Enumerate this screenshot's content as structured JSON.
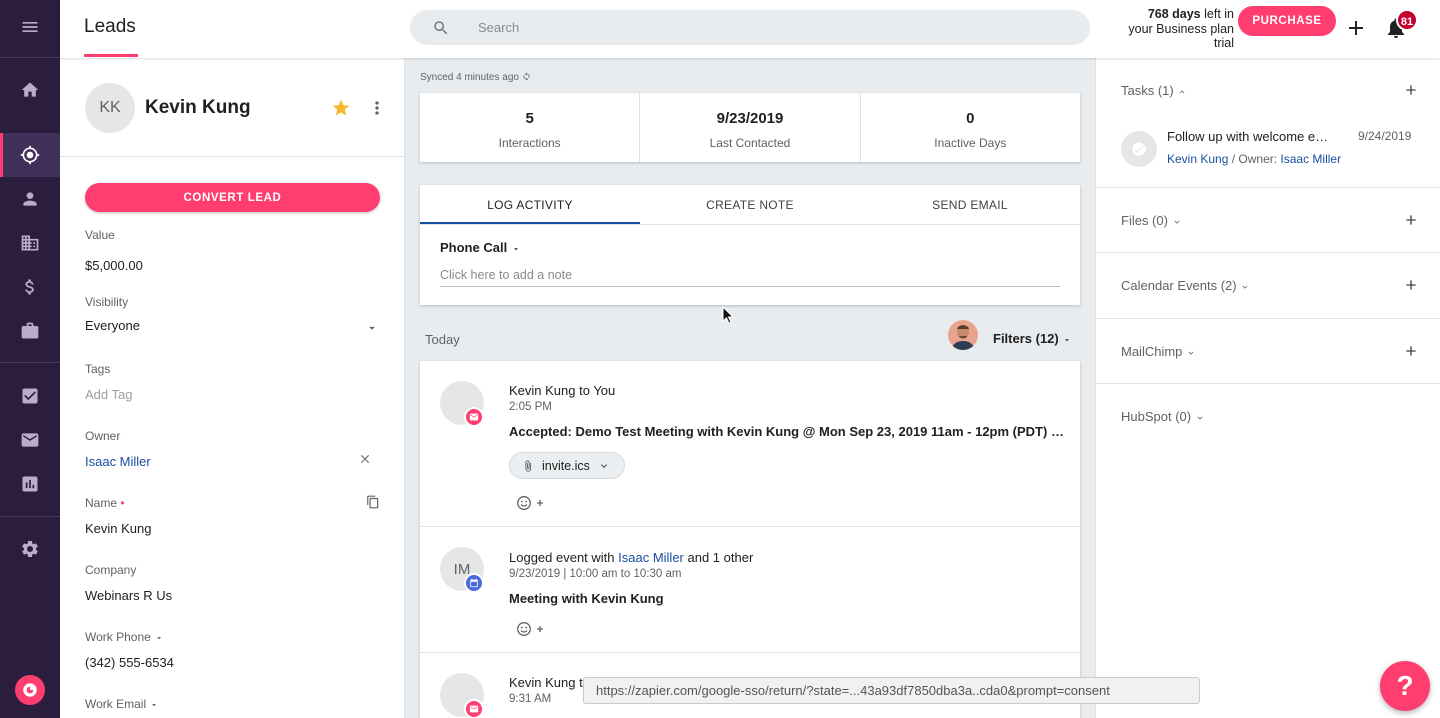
{
  "header": {
    "title": "Leads",
    "search_placeholder": "Search",
    "trial_days": "768 days",
    "trial_rest_1": " left in",
    "trial_rest_2": "your Business plan",
    "trial_rest_3": "trial",
    "purchase_label": "PURCHASE",
    "notifications_count": "81"
  },
  "lead": {
    "initials": "KK",
    "name": "Kevin Kung",
    "convert_label": "CONVERT LEAD",
    "fields": {
      "value_label": "Value",
      "value": "$5,000.00",
      "visibility_label": "Visibility",
      "visibility": "Everyone",
      "tags_label": "Tags",
      "tags_placeholder": "Add Tag",
      "owner_label": "Owner",
      "owner": "Isaac Miller",
      "name_label": "Name",
      "name_required": "•",
      "name": "Kevin Kung",
      "company_label": "Company",
      "company": "Webinars R Us",
      "work_phone_label": "Work Phone",
      "work_phone": "(342) 555-6534",
      "work_email_label": "Work Email"
    }
  },
  "middle": {
    "synced": "Synced 4 minutes ago",
    "stats": [
      {
        "value": "5",
        "label": "Interactions"
      },
      {
        "value": "9/23/2019",
        "label": "Last Contacted"
      },
      {
        "value": "0",
        "label": "Inactive Days"
      }
    ],
    "tabs": [
      "LOG ACTIVITY",
      "CREATE NOTE",
      "SEND EMAIL"
    ],
    "activity_type": "Phone Call",
    "note_placeholder": "Click here to add a note",
    "today_label": "Today",
    "filters_label": "Filters (12)",
    "feed": [
      {
        "title": "Kevin Kung to You",
        "time": "2:05 PM",
        "subject": "Accepted: Demo Test Meeting with Kevin Kung @ Mon Sep 23, 2019 11am - 12pm (PDT) (isaac@copper.com)",
        "attachment": "invite.ics"
      },
      {
        "initials": "IM",
        "title_prefix": "Logged event with ",
        "title_link": "Isaac Miller",
        "title_suffix": " and 1 other",
        "time": "9/23/2019 | 10:00 am to 10:30 am",
        "subject": "Meeting with Kevin Kung"
      },
      {
        "title": "Kevin Kung to You",
        "time": "9:31 AM"
      }
    ]
  },
  "right": {
    "tasks_title": "Tasks (1)",
    "task": {
      "title": "Follow up with welcome email to Kevin",
      "date": "9/24/2019",
      "contact": "Kevin Kung",
      "owner_prefix": " / Owner: ",
      "owner": "Isaac Miller"
    },
    "files_title": "Files (0)",
    "calendar_title": "Calendar Events (2)",
    "mailchimp_title": "MailChimp",
    "hubspot_title": "HubSpot (0)"
  },
  "status_url": "https://zapier.com/google-sso/return/?state=...43a93df7850dba3a..cda0&prompt=consent",
  "help_label": "?",
  "colors": {
    "accent": "#ff3d6e",
    "rail": "#2b1d3d",
    "link": "#1a4fa0"
  }
}
